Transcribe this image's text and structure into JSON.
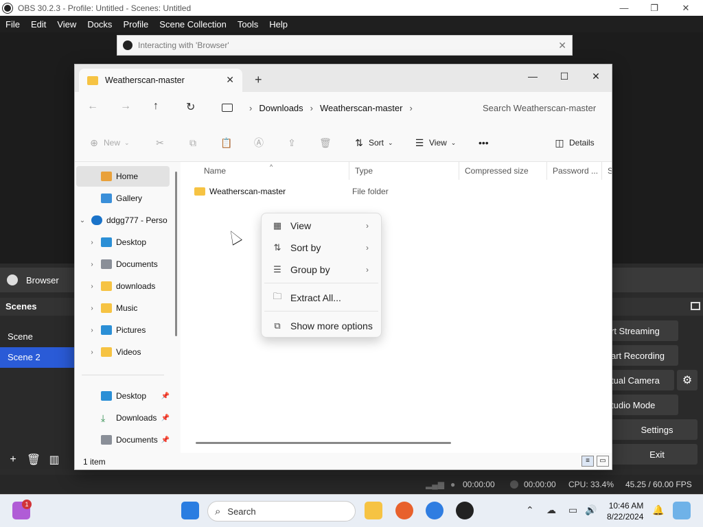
{
  "obs": {
    "title": "OBS 30.2.3 - Profile: Untitled - Scenes: Untitled",
    "window_controls": [
      "—",
      "❐",
      "✕"
    ],
    "menu": [
      "File",
      "Edit",
      "View",
      "Docks",
      "Profile",
      "Scene Collection",
      "Tools",
      "Help"
    ],
    "dialog_title": "Interacting with 'Browser'",
    "source_label": "Browser",
    "scenes_header": "Scenes",
    "scenes": [
      "Scene",
      "Scene 2"
    ],
    "controls": [
      "rt Streaming",
      "art Recording",
      "tual Camera",
      "tudio Mode",
      "Settings",
      "Exit"
    ],
    "status": {
      "stream_time": "00:00:00",
      "rec_time": "00:00:00",
      "cpu": "CPU: 33.4%",
      "fps": "45.25 / 60.00 FPS"
    }
  },
  "explorer": {
    "tab_title": "Weatherscan-master",
    "crumbs": [
      "Downloads",
      "Weatherscan-master"
    ],
    "search_placeholder": "Search Weatherscan-master",
    "toolbar": {
      "new": "New",
      "sort": "Sort",
      "view": "View",
      "more": "•••",
      "details": "Details"
    },
    "nav": {
      "home": "Home",
      "gallery": "Gallery",
      "onedrive": "ddgg777 - Perso",
      "desktop": "Desktop",
      "documents": "Documents",
      "downloads": "downloads",
      "music": "Music",
      "pictures": "Pictures",
      "videos": "Videos",
      "pin_desktop": "Desktop",
      "pin_downloads": "Downloads",
      "pin_documents": "Documents"
    },
    "columns": [
      "Name",
      "Type",
      "Compressed size",
      "Password ...",
      "Si"
    ],
    "files": [
      {
        "name": "Weatherscan-master",
        "type": "File folder"
      }
    ],
    "item_count": "1 item"
  },
  "context_menu": {
    "view": "View",
    "sort_by": "Sort by",
    "group_by": "Group by",
    "extract_all": "Extract All...",
    "show_more": "Show more options"
  },
  "taskbar": {
    "search": "Search",
    "notification_count": "1",
    "time": "10:46 AM",
    "date": "8/22/2024"
  }
}
